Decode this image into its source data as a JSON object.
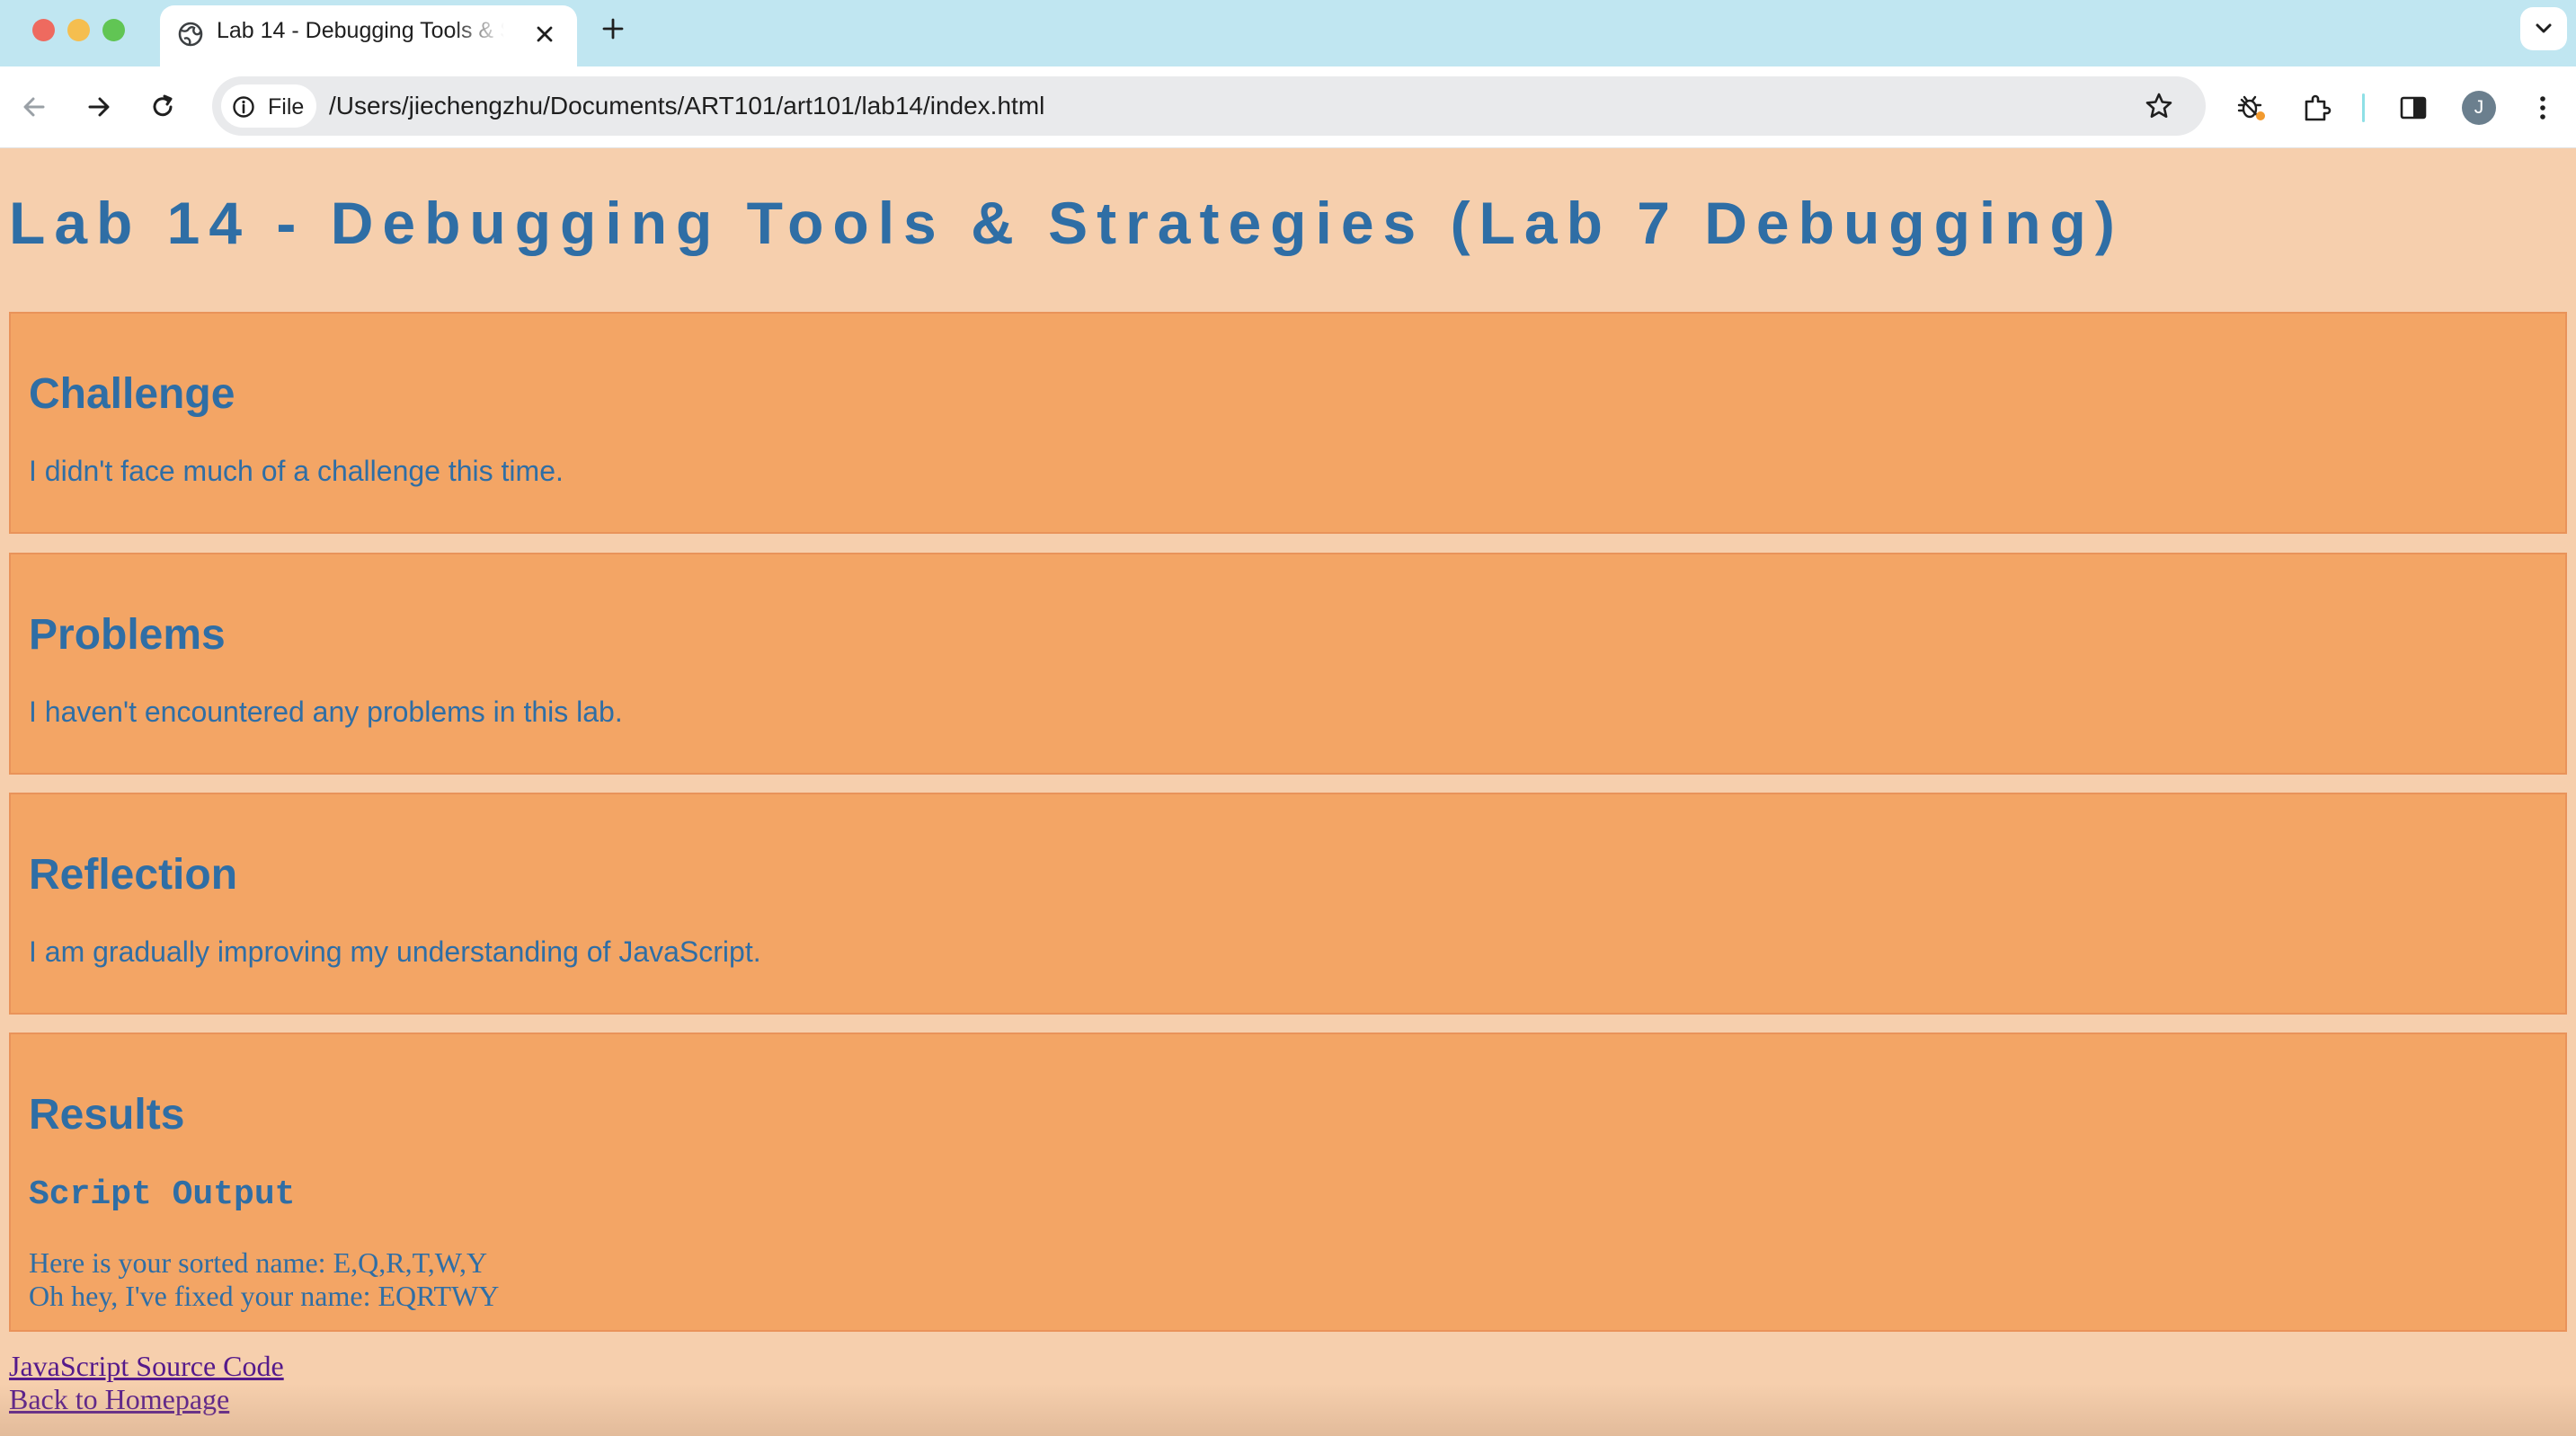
{
  "browser": {
    "tab_title": "Lab 14 - Debugging Tools & Strategies (Lab 7 Debugging)",
    "site_chip": "File",
    "url": "/Users/jiechengzhu/Documents/ART101/art101/lab14/index.html",
    "profile_initial": "J"
  },
  "page": {
    "title": "Lab 14 - Debugging Tools & Strategies (Lab 7 Debugging)",
    "sections": [
      {
        "heading": "Challenge",
        "text": "I didn't face much of a challenge this time."
      },
      {
        "heading": "Problems",
        "text": "I haven't encountered any problems in this lab."
      },
      {
        "heading": "Reflection",
        "text": "I am gradually improving my understanding of JavaScript."
      }
    ],
    "results": {
      "heading": "Results",
      "subheading": "Script Output",
      "lines": [
        "Here is your sorted name: E,Q,R,T,W,Y",
        "Oh hey, I've fixed your name: EQRTWY"
      ]
    },
    "links": {
      "source": "JavaScript Source Code",
      "home": "Back to Homepage"
    }
  },
  "colors": {
    "background": "#f6cfad",
    "card": "#f3a565",
    "heading": "#2f6ea5",
    "tabbar": "#c0e6f1"
  }
}
